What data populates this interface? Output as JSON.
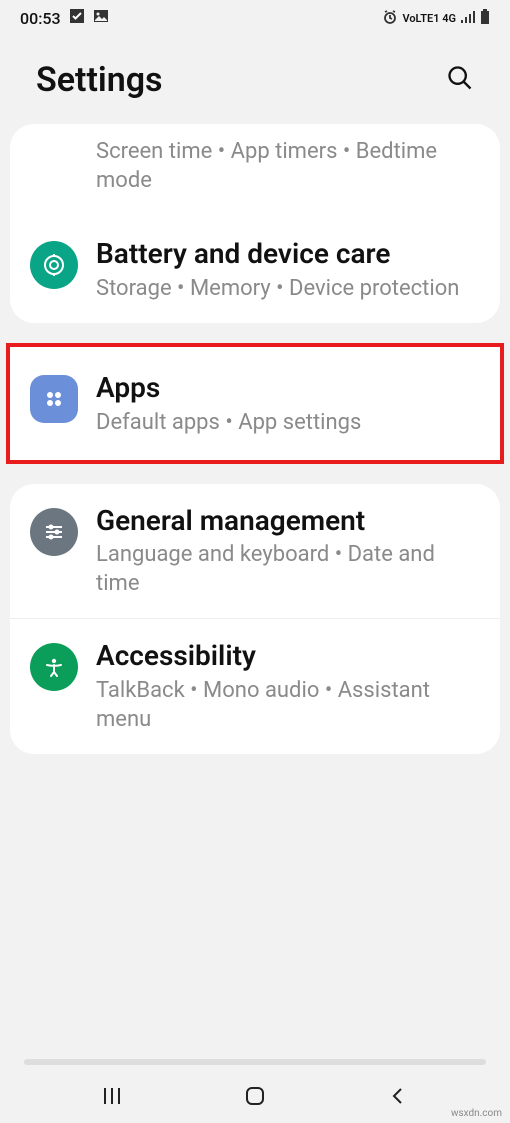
{
  "status": {
    "time": "00:53",
    "indicators": "VoLTE1 4G"
  },
  "header": {
    "title": "Settings"
  },
  "group1": {
    "partial_sub": "Screen time  •  App timers  •  Bedtime mode",
    "battery": {
      "title": "Battery and device care",
      "sub": "Storage  •  Memory  •  Device protection"
    }
  },
  "apps": {
    "title": "Apps",
    "sub": "Default apps  •  App settings"
  },
  "group2": {
    "general": {
      "title": "General management",
      "sub": "Language and keyboard  •  Date and time"
    },
    "accessibility": {
      "title": "Accessibility",
      "sub": "TalkBack  •  Mono audio  •  Assistant menu"
    }
  },
  "watermark": "wsxdn.com"
}
